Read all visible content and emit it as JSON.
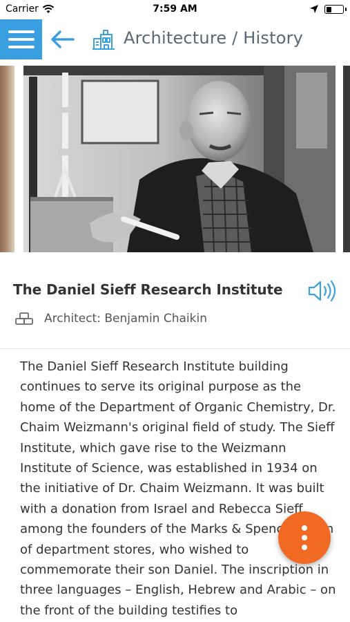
{
  "status_bar": {
    "carrier": "Carrier",
    "time": "7:59 AM",
    "battery_level": 0.35,
    "icons": [
      "wifi-icon",
      "location-arrow-icon",
      "battery-icon"
    ]
  },
  "header": {
    "menu_icon": "hamburger-menu-icon",
    "back_icon": "back-arrow-icon",
    "section_icon": "building-icon",
    "title": "Architecture / History",
    "accent_color": "#3a9fe0",
    "title_color": "#5a6672"
  },
  "place": {
    "name": "The Daniel Sieff Research Institute",
    "architect": "Architect: Benjamin Chaikin",
    "architect_icon": "blocks-icon",
    "audio_icon": "speaker-audio-icon"
  },
  "description": "The Daniel Sieff Research Institute building continues to serve its original purpose as the home of the Department of Organic Chemistry, Dr. Chaim Weizmann's original field of study. The Sieff Institute, which gave rise to the Weizmann Institute of Science, was established in 1934 on the initiative of Dr. Chaim Weizmann. It was built with a donation from Israel and Rebecca Sieff, among the founders of the Marks & Spencer chain of department stores, who wished to commemorate their son Daniel. The inscription in three languages – English, Hebrew and Arabic – on the front of the building testifies to",
  "fab": {
    "icon": "more-vertical-icon",
    "color": "#f06a24"
  }
}
